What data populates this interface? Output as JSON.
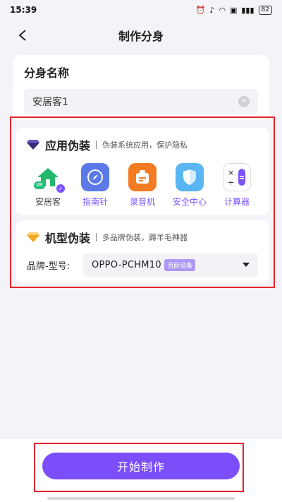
{
  "status_bar": {
    "time": "15:39",
    "battery": "82"
  },
  "header": {
    "title": "制作分身"
  },
  "name_section": {
    "label": "分身名称",
    "value": "安居客1"
  },
  "app_disguise": {
    "title": "应用伪装",
    "subtitle": "伪装系统应用，保护隐私",
    "apps": [
      {
        "name": "安居客",
        "icon": "home-icon",
        "badge": "VR",
        "selected": true
      },
      {
        "name": "指南针",
        "icon": "compass-icon",
        "selected": false
      },
      {
        "name": "录音机",
        "icon": "recorder-icon",
        "selected": false
      },
      {
        "name": "安全中心",
        "icon": "shield-icon",
        "selected": false
      },
      {
        "name": "计算器",
        "icon": "calculator-icon",
        "selected": false
      }
    ]
  },
  "model_disguise": {
    "title": "机型伪装",
    "subtitle": "多品牌伪装，薅羊毛神器",
    "field_label": "品牌-型号:",
    "value": "OPPO-PCHM10",
    "tag": "当前设备"
  },
  "action": {
    "start_label": "开始制作"
  },
  "colors": {
    "accent": "#7b4dfb",
    "highlight_box": "#e4242d"
  }
}
